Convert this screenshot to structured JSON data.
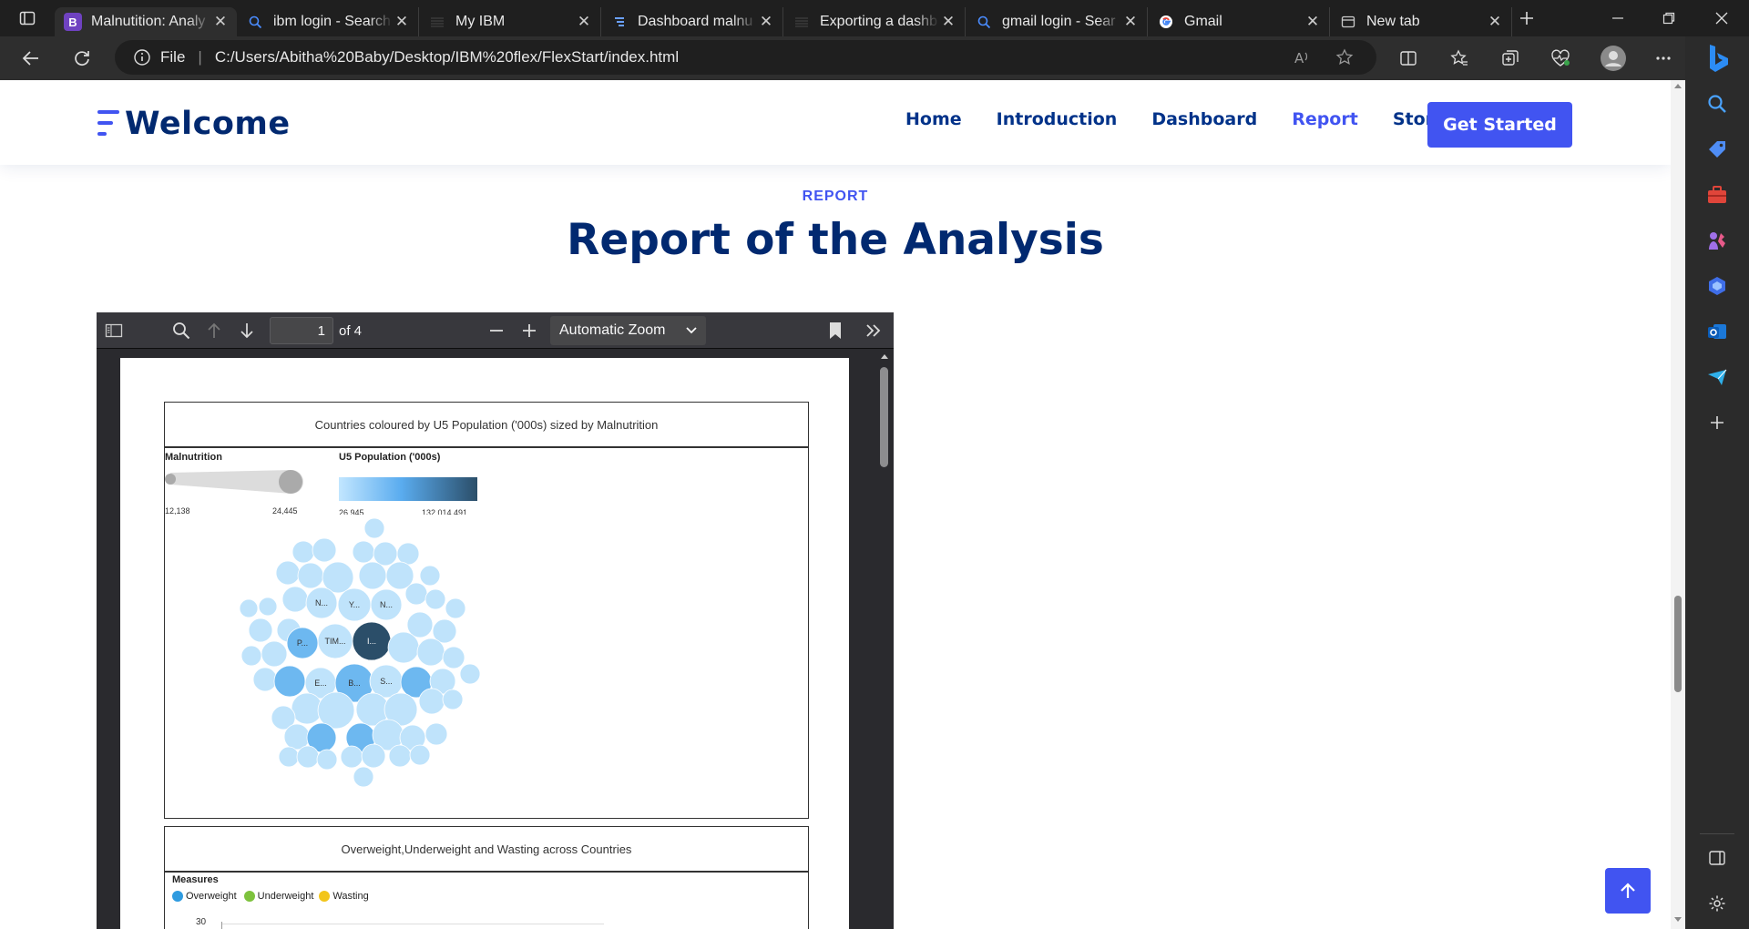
{
  "browser": {
    "tabs": [
      {
        "title": "Malnutition: Analy",
        "favicon": "B",
        "active": true
      },
      {
        "title": "ibm login - Search",
        "favicon": "search-icon"
      },
      {
        "title": "My IBM",
        "favicon": "ibm-icon"
      },
      {
        "title": "Dashboard malnu",
        "favicon": "dashboard-icon"
      },
      {
        "title": "Exporting a dashb",
        "favicon": "ibm-icon"
      },
      {
        "title": "gmail login - Sear",
        "favicon": "search-icon"
      },
      {
        "title": "Gmail",
        "favicon": "google-icon"
      },
      {
        "title": "New tab",
        "favicon": "newtab-icon"
      }
    ],
    "address": {
      "scheme_label": "File",
      "url": "C:/Users/Abitha%20Baby/Desktop/IBM%20flex/FlexStart/index.html"
    }
  },
  "site": {
    "logo": "Welcome",
    "nav": [
      "Home",
      "Introduction",
      "Dashboard",
      "Report",
      "Story"
    ],
    "active_nav": "Report",
    "cta": "Get Started",
    "section_label": "REPORT",
    "section_title": "Report of the Analysis"
  },
  "pdf_viewer": {
    "page_number": "1",
    "page_count": "of 4",
    "zoom": "Automatic Zoom"
  },
  "report_page": {
    "viz1": {
      "title": "Countries coloured by U5 Population ('000s) sized by Malnutrition",
      "size_legend": {
        "title": "Malnutrition",
        "min": "12,138",
        "max": "24,445"
      },
      "color_legend": {
        "title": "U5 Population ('000s)",
        "min": "26,945",
        "max": "132,014,491"
      },
      "bubble_labels": [
        "N...",
        "Y...",
        "N...",
        "P...",
        "TIM...",
        "I...",
        "E...",
        "B...",
        "S..."
      ]
    },
    "viz2": {
      "title": "Overweight,Underweight and Wasting across Countries",
      "legend_title": "Measures",
      "measures": [
        {
          "name": "Overweight",
          "color": "#2e9be0"
        },
        {
          "name": "Underweight",
          "color": "#7dc23d"
        },
        {
          "name": "Wasting",
          "color": "#f2c51b"
        }
      ],
      "y_tick": "30"
    }
  },
  "colors": {
    "brand": "#4154f1",
    "heading": "#012970",
    "bubble_light": "#bfe3fb",
    "bubble_mid": "#6db8f0",
    "bubble_dark": "#2b4e69"
  }
}
